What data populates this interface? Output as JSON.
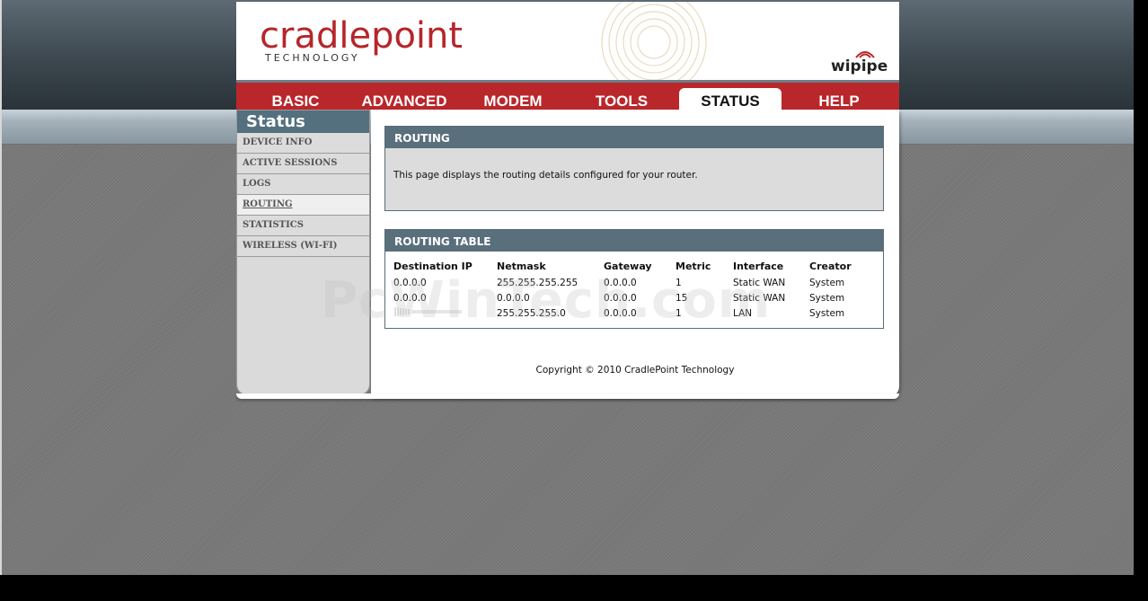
{
  "brand": {
    "logo_text": "cradlepoint",
    "logo_sub": "TECHNOLOGY",
    "wipipe": "wipipe",
    "accent_color": "#b9272b",
    "header_blue": "#5a6f7c"
  },
  "nav": {
    "tabs": [
      {
        "label": "BASIC"
      },
      {
        "label": "ADVANCED"
      },
      {
        "label": "MODEM"
      },
      {
        "label": "TOOLS"
      },
      {
        "label": "STATUS"
      },
      {
        "label": "HELP"
      }
    ],
    "active": "STATUS"
  },
  "sidebar": {
    "title": "Status",
    "items": [
      {
        "label": "DEVICE INFO"
      },
      {
        "label": "ACTIVE SESSIONS"
      },
      {
        "label": "LOGS"
      },
      {
        "label": "ROUTING"
      },
      {
        "label": "STATISTICS"
      },
      {
        "label": "WIRELESS (WI-FI)"
      }
    ],
    "active": "ROUTING"
  },
  "routing": {
    "title": "ROUTING",
    "description": "This page displays the routing details configured for your router."
  },
  "routing_table": {
    "title": "ROUTING TABLE",
    "columns": [
      "Destination IP",
      "Netmask",
      "Gateway",
      "Metric",
      "Interface",
      "Creator"
    ],
    "rows": [
      [
        "0.0.0.0",
        "255.255.255.255",
        "0.0.0.0",
        "1",
        "Static WAN",
        "System"
      ],
      [
        "0.0.0.0",
        "0.0.0.0",
        "0.0.0.0",
        "15",
        "Static WAN",
        "System"
      ],
      [
        "",
        "255.255.255.0",
        "0.0.0.0",
        "1",
        "LAN",
        "System"
      ]
    ]
  },
  "watermark": "PcWinTech.com",
  "footer": {
    "copyright": "Copyright © 2010 CradlePoint Technology"
  }
}
